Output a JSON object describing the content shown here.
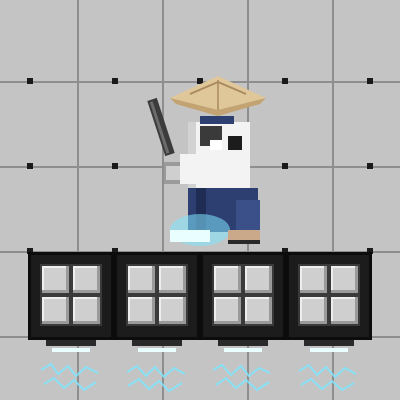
{
  "scene": {
    "background_tile_color": "#c4c4c4",
    "grid_line_color": "#8e8e8e",
    "platform_block_color": "#1c1c1c",
    "platform_cell_color": "#cfcfcf",
    "glow_color": "#7fe6ff"
  },
  "platform": {
    "block_count": 4
  },
  "character": {
    "name_icon": "ronin-samurai-sprite",
    "hat_color": "#e0c79a",
    "robe_color": "#f3f3f3",
    "hakama_color": "#2d3e70",
    "sword_color": "#3b3b3b"
  }
}
